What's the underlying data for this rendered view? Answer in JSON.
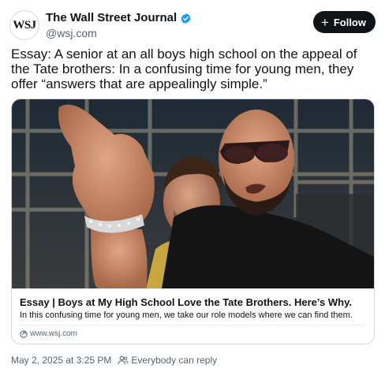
{
  "account": {
    "avatar_text": "WSJ",
    "display_name": "The Wall Street Journal",
    "handle": "@wsj.com",
    "follow_label": "Follow",
    "follow_icon": "plus-icon",
    "verified_icon": "verified-badge-icon"
  },
  "post": {
    "text": "Essay: A senior at an all boys high school on the appeal of the Tate brothers: In a confusing time for young men, they offer “answers that are appealingly simple.”"
  },
  "card": {
    "image_alt": "Two men smiling, one wearing sunglasses and pointing at the camera",
    "title": "Essay | Boys at My High School Love the Tate Brothers. Here’s Why.",
    "description": "In this confusing time for young men, we take our role models where we can find them.",
    "domain": "www.wsj.com",
    "domain_icon": "link-icon"
  },
  "footer": {
    "timestamp": "May 2, 2025 at 3:25 PM",
    "reply_setting": "Everybody can reply",
    "reply_icon": "people-icon"
  },
  "colors": {
    "accent": "#1d9bf0",
    "follow_bg": "#0f1419",
    "secondary_text": "#536471",
    "border": "#cfd9de"
  }
}
